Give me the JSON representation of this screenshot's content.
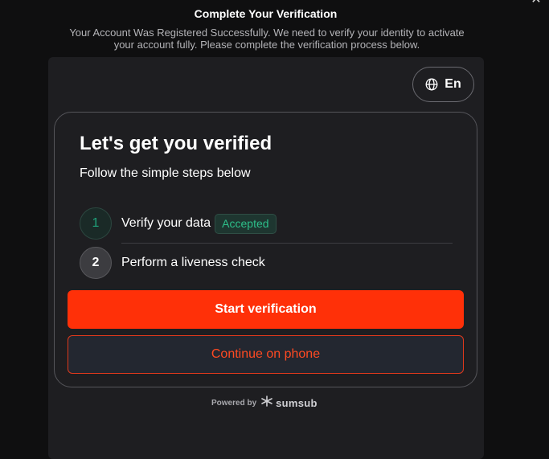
{
  "modal": {
    "title": "Complete Your Verification",
    "subtitle": "Your Account Was Registered Successfully. We need to verify your identity to activate your account fully. Please complete the verification process below.",
    "close_icon": "close-icon"
  },
  "language": {
    "label": "En",
    "icon": "globe-icon"
  },
  "card": {
    "title": "Let's get you verified",
    "subtitle": "Follow the simple steps below",
    "steps": [
      {
        "number": "1",
        "label": "Verify your data",
        "badge": "Accepted",
        "status_color": "#2dbf8a"
      },
      {
        "number": "2",
        "label": "Perform a liveness check"
      }
    ],
    "primary_button": "Start verification",
    "secondary_button": "Continue on phone"
  },
  "footer": {
    "powered_by": "Powered by",
    "brand": "sumsub",
    "brand_icon": "sumsub-logo-icon"
  },
  "colors": {
    "accent": "#ff3008",
    "background": "#1e1e21",
    "success": "#2dbf8a"
  }
}
